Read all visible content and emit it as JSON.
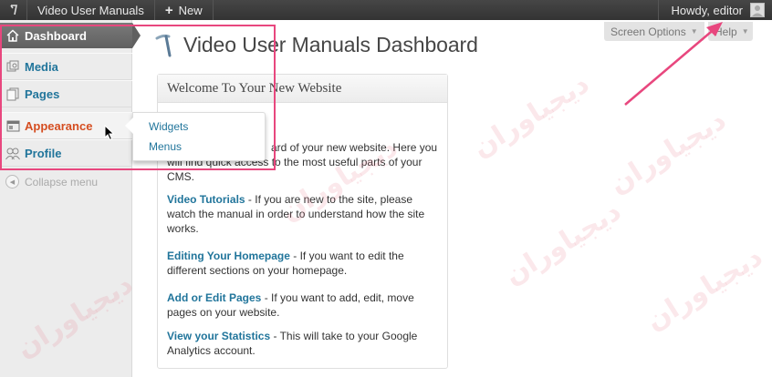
{
  "admin_bar": {
    "site_name": "Video User Manuals",
    "new_label": "New",
    "greeting": "Howdy, editor"
  },
  "sidebar": {
    "items": [
      {
        "label": "Dashboard"
      },
      {
        "label": "Media"
      },
      {
        "label": "Pages"
      },
      {
        "label": "Appearance"
      },
      {
        "label": "Profile"
      }
    ],
    "collapse_label": "Collapse menu"
  },
  "flyout": {
    "items": [
      {
        "label": "Widgets"
      },
      {
        "label": "Menus"
      }
    ]
  },
  "screen_meta": {
    "screen_options": "Screen Options",
    "help": "Help"
  },
  "page": {
    "title": "Video User Manuals Dashboard"
  },
  "welcome": {
    "title": "Welcome To Your New Website",
    "intro": "ard of your new website. Here you will find quick access to the most useful parts of your CMS.",
    "sections": [
      {
        "heading": "Video Tutorials",
        "text": " - If you are new to the site, please watch the manual in order to understand how the site works."
      },
      {
        "heading": "Editing Your Homepage",
        "text": " - If you want to edit the different sections on your homepage."
      },
      {
        "heading": "Add or Edit Pages",
        "text": " - If you want to add, edit, move pages on your website."
      },
      {
        "heading": "View your Statistics",
        "text": " - This will take to your Google Analytics account."
      }
    ]
  },
  "colors": {
    "link": "#21759b",
    "active": "#d54e21",
    "annotation": "#e8477e"
  }
}
